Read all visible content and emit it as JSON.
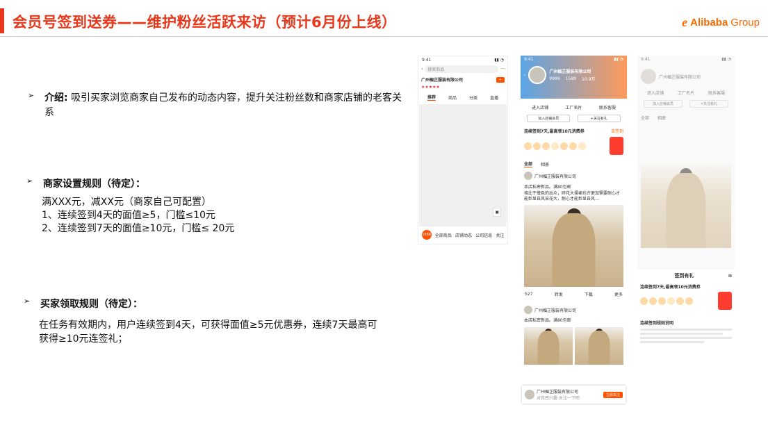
{
  "header": {
    "title": "会员号签到送券——维护粉丝活跃来访（预计6月份上线）",
    "logo_mark": "e",
    "logo_text": "Alibaba",
    "logo_group": "Group",
    "accent": "#e8381b"
  },
  "intro": {
    "label": "介绍:",
    "text": "吸引买家浏览商家自己发布的动态内容，提升关注粉丝数和商家店铺的老客关系"
  },
  "merchant_rules": {
    "heading": "商家设置规则（待定）：",
    "lines": [
      "满XXX元，减XX元（商家自己可配置）",
      "1、连续签到4天的面值≥5，门槛≤10元",
      "2、连续签到7天的面值≥10元，门槛≤ 20元"
    ]
  },
  "buyer_rules": {
    "heading": "买家领取规则（待定）：",
    "text": "在任务有效期内，用户连续签到4天，可获得面值≥5元优惠券，连续7天最高可获得≥10元连签礼；"
  },
  "bullet_glyph": "➢",
  "phone1": {
    "time": "9:41",
    "search_placeholder": "搜索商品",
    "shop_name": "广州楣芷服装有限公司",
    "tabs": [
      "推荐",
      "商品",
      "分类",
      "直播"
    ],
    "bottom_nav": [
      "1688",
      "全部商品",
      "店铺动态",
      "公司信息",
      "关注"
    ]
  },
  "phone2": {
    "time": "9:41",
    "shop_name": "广州楣芷服装有限公司",
    "stats": [
      "9999",
      "1589",
      "10.9万"
    ],
    "actions": [
      "进入店铺",
      "工厂名片",
      "联系客服"
    ],
    "buttons": [
      "加入店铺会员",
      "+关注有礼"
    ],
    "sign_title": "连续签到7天,最高领10元消费券",
    "sign_button": "去签到",
    "feed_tabs": [
      "全部",
      "相册"
    ],
    "post_shop": "广州楣芷服装有限公司",
    "post_text": "本店私密新品。满80包邮",
    "post_text2": "相比于撞色的出众，碎花大摆裙也许更加需要耐心才能彰显自风采花大，耐心才能彰显自风…",
    "post_actions": [
      "527",
      "转发",
      "下载",
      "更多"
    ],
    "follow_bar_name": "广州楣芷服装有限公司",
    "follow_bar_sub": "对我感兴趣 关注一下吧",
    "follow_button": "立即关注"
  },
  "phone3": {
    "time": "9:41",
    "shop_name": "广州楣芷服装有限公司",
    "actions": [
      "进入店铺",
      "工厂名片",
      "联系客服"
    ],
    "buttons": [
      "加入店铺会员",
      "+关注有礼"
    ],
    "feed_tabs": [
      "全部",
      "相册"
    ],
    "sign_label": "签到有礼",
    "sign_title": "连续签到7天,最高领10元消费券",
    "rules_title": "连续签到规则说明"
  }
}
